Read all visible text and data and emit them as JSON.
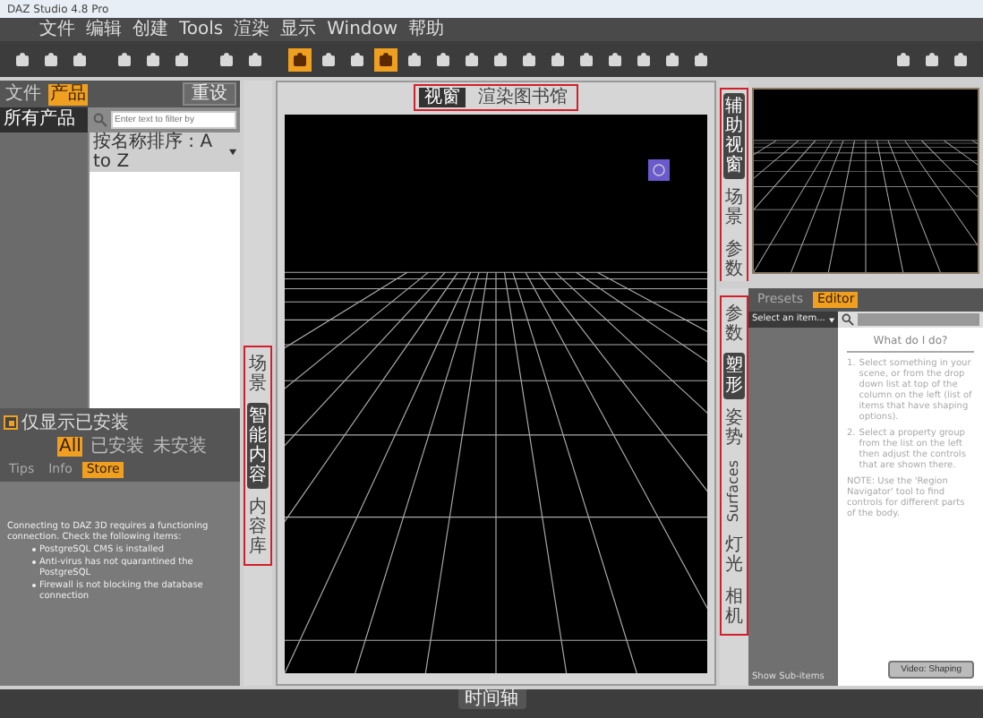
{
  "window": {
    "title": "DAZ Studio 4.8 Pro"
  },
  "menu": [
    "文件",
    "编辑",
    "创建",
    "Tools",
    "渲染",
    "显示",
    "Window",
    "帮助"
  ],
  "toolbar": [
    {
      "kind": "tool",
      "selected": false
    },
    {
      "kind": "tool",
      "selected": false
    },
    {
      "kind": "tool",
      "selected": false
    },
    {
      "kind": "separator"
    },
    {
      "kind": "tool",
      "selected": false
    },
    {
      "kind": "tool",
      "selected": false
    },
    {
      "kind": "tool",
      "selected": false
    },
    {
      "kind": "separator"
    },
    {
      "kind": "tool",
      "selected": false
    },
    {
      "kind": "tool",
      "selected": false
    },
    {
      "kind": "separator"
    },
    {
      "kind": "tool",
      "selected": true
    },
    {
      "kind": "tool",
      "selected": false
    },
    {
      "kind": "tool",
      "selected": false
    },
    {
      "kind": "tool",
      "selected": true
    },
    {
      "kind": "tool",
      "selected": false
    },
    {
      "kind": "tool",
      "selected": false
    },
    {
      "kind": "tool",
      "selected": false
    },
    {
      "kind": "tool",
      "selected": false
    },
    {
      "kind": "tool",
      "selected": false
    },
    {
      "kind": "tool",
      "selected": false
    },
    {
      "kind": "tool",
      "selected": false
    },
    {
      "kind": "tool",
      "selected": false
    },
    {
      "kind": "tool",
      "selected": false
    },
    {
      "kind": "tool",
      "selected": false
    },
    {
      "kind": "tool",
      "selected": false
    },
    {
      "kind": "spacer"
    },
    {
      "kind": "tool",
      "selected": false
    },
    {
      "kind": "tool",
      "selected": false
    },
    {
      "kind": "tool",
      "selected": false
    }
  ],
  "left_panel": {
    "tabs": [
      {
        "label": "文件",
        "selected": false
      },
      {
        "label": "产品",
        "selected": true
      }
    ],
    "menu_button": "重设",
    "categories": [
      {
        "label": "所有产品",
        "selected": true
      }
    ],
    "search": {
      "placeholder": "Enter text to filter by"
    },
    "sort": "按名称排序 : A to Z",
    "installed_only": {
      "label": "仅显示已安装",
      "checked": true
    },
    "filter_tabs": [
      {
        "label": "All",
        "selected": true
      },
      {
        "label": "已安装",
        "selected": false
      },
      {
        "label": "未安装",
        "selected": false
      }
    ],
    "info_tabs": [
      {
        "label": "Tips",
        "selected": false
      },
      {
        "label": "Info",
        "selected": false
      },
      {
        "label": "Store",
        "selected": true
      }
    ],
    "message": "Connecting to DAZ 3D requires a functioning connection. Check the following items:",
    "bullets": [
      "PostgreSQL CMS is installed",
      "Anti-virus has not quarantined the PostgreSQL",
      "Firewall is not blocking the database connection"
    ]
  },
  "left_dock_tabs": {
    "highlighted": true,
    "tabs": [
      {
        "label": "场景",
        "selected": false
      },
      {
        "label": "智能内容",
        "selected": true
      },
      {
        "label": "内容库",
        "selected": false
      }
    ]
  },
  "viewport": {
    "highlighted": true,
    "tabs": [
      {
        "label": "视窗",
        "selected": true
      },
      {
        "label": "渲染图书馆",
        "selected": false
      }
    ]
  },
  "aux_dock_tabs": {
    "highlighted": true,
    "tabs": [
      {
        "label": "辅助视窗",
        "selected": true
      },
      {
        "label": "场景",
        "selected": false
      },
      {
        "label": "参数",
        "selected": false
      }
    ]
  },
  "right_panel": {
    "tabs": [
      {
        "label": "Presets",
        "selected": false
      },
      {
        "label": "Editor",
        "selected": true
      }
    ],
    "select": "Select an item...",
    "help_title": "What do I do?",
    "steps": [
      {
        "number": "1.",
        "text": "Select something in your scene, or from the drop down list at top of the column on the left (list of items that have shaping options)."
      },
      {
        "number": "2.",
        "text": "Select a property group from the list on the left then adjust the controls that are shown there."
      },
      {
        "text": "NOTE: Use the 'Region Navigator' tool to find controls for different parts of the body."
      }
    ],
    "video_button": "Video: Shaping",
    "show_sub": "Show Sub-items"
  },
  "right_dock_tabs": {
    "highlighted": true,
    "tabs": [
      {
        "label": "参数",
        "kind": "cjk",
        "selected": false
      },
      {
        "label": "塑形",
        "kind": "cjk",
        "selected": true
      },
      {
        "label": "姿势",
        "kind": "cjk",
        "selected": false
      },
      {
        "label": "Surfaces",
        "kind": "latin",
        "selected": false
      },
      {
        "label": "灯光",
        "kind": "cjk",
        "selected": false
      },
      {
        "label": "相机",
        "kind": "cjk",
        "selected": false
      }
    ]
  },
  "timeline": {
    "label": "时间轴"
  }
}
